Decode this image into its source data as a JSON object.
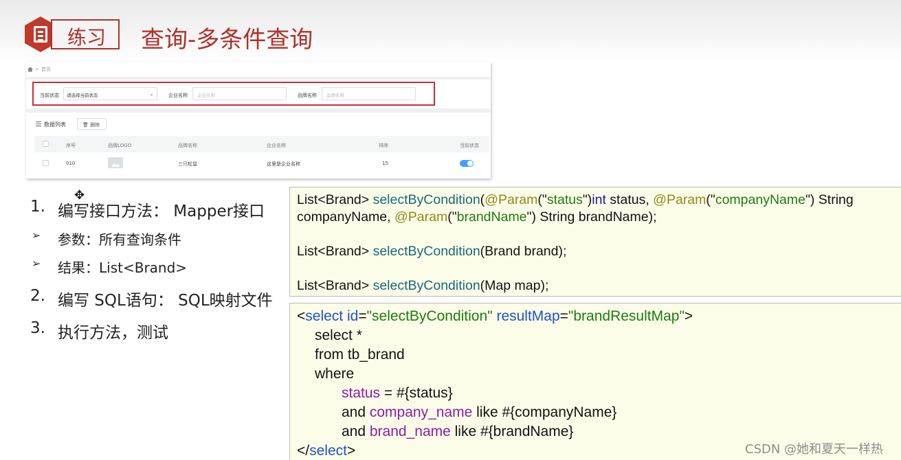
{
  "header": {
    "tag": "练习",
    "title": "查询-多条件查询"
  },
  "mini_ui": {
    "breadcrumb": "首页",
    "filters": {
      "status_label": "当前状态",
      "status_selected": "请选择当前状态",
      "company_label": "企业名称",
      "company_placeholder": "企业名称",
      "brand_label": "品牌名称",
      "brand_placeholder": "品牌名称"
    },
    "list_title": "数据列表",
    "delete_button": "删除",
    "columns": [
      "序号",
      "品牌LOGO",
      "品牌名称",
      "企业名称",
      "排序",
      "当前状态"
    ],
    "row": {
      "id": "010",
      "brand": "三只松鼠",
      "company": "这里是企业名称",
      "order": "15",
      "status_on": true
    }
  },
  "steps": {
    "s1_num": "1.",
    "s1_text": "编写接口方法： Mapper接口",
    "b1_text": "参数：所有查询条件",
    "b2_text": "结果：List<Brand>",
    "s2_num": "2.",
    "s2_text": "编写 SQL语句： SQL映射文件",
    "s3_num": "3.",
    "s3_text": "执行方法，测试",
    "bullet": "➢"
  },
  "code1": {
    "l1_a": "List<Brand> ",
    "l1_fn": "selectByCondition",
    "l1_b": "(",
    "l1_ann1": "@Param",
    "l1_c": "(\"",
    "l1_s1": "status",
    "l1_d": "\")",
    "l1_kw": "int",
    "l1_e": " status, ",
    "l1_ann2": "@Param",
    "l1_f": "(\"",
    "l1_s2": "companyName",
    "l1_g": "\") String",
    "l2_a": "companyName, ",
    "l2_ann": "@Param",
    "l2_b": "(\"",
    "l2_s": "brandName",
    "l2_c": "\") String brandName);",
    "l3_a": "List<Brand> ",
    "l3_fn": "selectByCondition",
    "l3_b": "(Brand brand);",
    "l4_a": "List<Brand> ",
    "l4_fn": "selectByCondition",
    "l4_b": "(Map map);"
  },
  "code2": {
    "l1_lt": "<",
    "l1_tag": "select",
    "l1_sp": " ",
    "l1_attr1": "id",
    "l1_eq1": "=",
    "l1_val1": "\"selectByCondition\"",
    "l1_sp2": " ",
    "l1_attr2": "resultMap",
    "l1_eq2": "=",
    "l1_val2": "\"brandResultMap\"",
    "l1_gt": ">",
    "l2": "select *",
    "l3": "from tb_brand",
    "l4": "where",
    "l5_col": "status",
    "l5_rest": " = #{status}",
    "l6_kw": "and ",
    "l6_col": "company_name",
    "l6_rest": " like #{companyName}",
    "l7_kw": "and ",
    "l7_col": "brand_name",
    "l7_rest": " like #{brandName}",
    "l8_lt": "</",
    "l8_tag": "select",
    "l8_gt": ">"
  },
  "watermark": "CSDN @她和夏天一样热"
}
